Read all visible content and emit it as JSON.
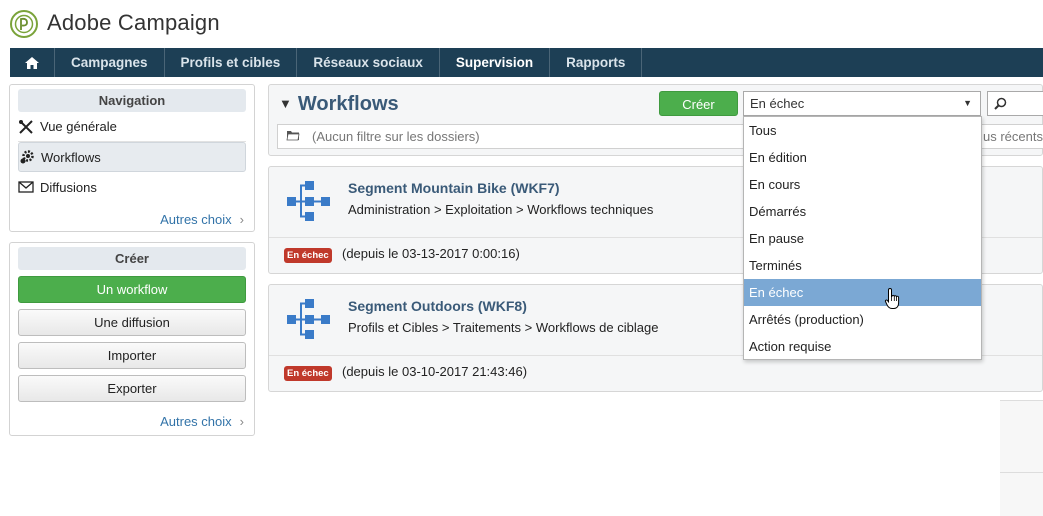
{
  "app": {
    "title": "Adobe Campaign"
  },
  "topnav": {
    "items": [
      {
        "label": "Campagnes"
      },
      {
        "label": "Profils et cibles"
      },
      {
        "label": "Réseaux sociaux"
      },
      {
        "label": "Supervision",
        "active": true
      },
      {
        "label": "Rapports"
      }
    ]
  },
  "navigation": {
    "title": "Navigation",
    "items": [
      {
        "label": "Vue générale",
        "icon": "tools-icon"
      },
      {
        "label": "Workflows",
        "icon": "gear-icon",
        "selected": true
      },
      {
        "label": "Diffusions",
        "icon": "envelope-icon"
      }
    ],
    "more": "Autres choix"
  },
  "create_panel": {
    "title": "Créer",
    "buttons": [
      "Un workflow",
      "Une diffusion",
      "Importer",
      "Exporter"
    ],
    "more": "Autres choix"
  },
  "main": {
    "title": "Workflows",
    "create_label": "Créer",
    "status_selected": "En échec",
    "filter_text": "(Aucun filtre sur les dossiers)",
    "recent_text": "us récents"
  },
  "workflows": [
    {
      "title": "Segment Mountain Bike (WKF7)",
      "path": "Administration > Exploitation > Workflows techniques",
      "status": "En échec",
      "since": "(depuis le 03-13-2017 0:00:16)"
    },
    {
      "title": "Segment Outdoors (WKF8)",
      "path": "Profils et Cibles > Traitements > Workflows de ciblage",
      "status": "En échec",
      "since": "(depuis le 03-10-2017 21:43:46)"
    }
  ],
  "status_options": [
    "Tous",
    "En édition",
    "En cours",
    "Démarrés",
    "En pause",
    "Terminés",
    "En échec",
    "Arrêtés (production)",
    "Action requise"
  ],
  "colors": {
    "nav_bg": "#1d3f55",
    "accent_green": "#4cae4c",
    "badge_red": "#c0392b",
    "hover_blue": "#7ba8d4",
    "title_blue": "#3a5a78"
  }
}
